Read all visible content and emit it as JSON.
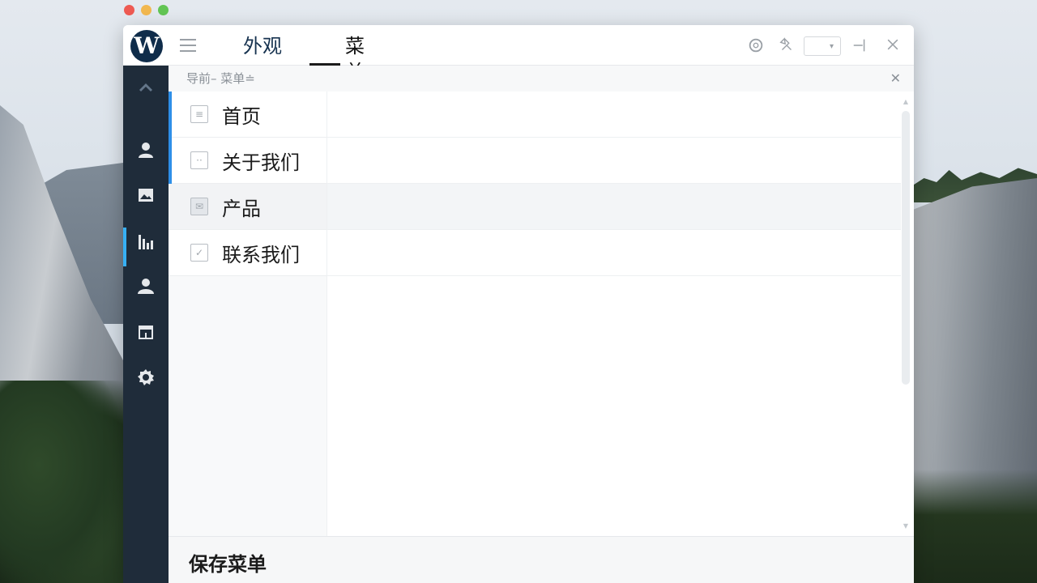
{
  "window": {
    "logo_letter": "W",
    "tabs": [
      {
        "label": "外观",
        "active": false
      },
      {
        "label": "菜单",
        "active": true
      }
    ]
  },
  "breadcrumb": {
    "text": "导前– 菜单≐"
  },
  "menu": {
    "items": [
      {
        "label": "首页",
        "icon": "page-icon",
        "marked": true,
        "selected": false
      },
      {
        "label": "关于我们",
        "icon": "face-icon",
        "marked": true,
        "selected": false
      },
      {
        "label": "产品",
        "icon": "envelope-icon",
        "marked": false,
        "selected": true
      },
      {
        "label": "联系我们",
        "icon": "check-icon",
        "marked": false,
        "selected": false
      }
    ]
  },
  "sidebar": {
    "icons": [
      "chevron-up-icon",
      "user-icon",
      "image-icon",
      "chart-icon",
      "person-icon",
      "calendar-icon",
      "gear-icon"
    ],
    "active": "chart-icon"
  },
  "footer": {
    "save_label": "保存菜单"
  },
  "colors": {
    "rail_bg": "#1f2c3a",
    "accent": "#37b0f4",
    "marker": "#2e8fe8",
    "logo_bg": "#0f2c4a"
  }
}
